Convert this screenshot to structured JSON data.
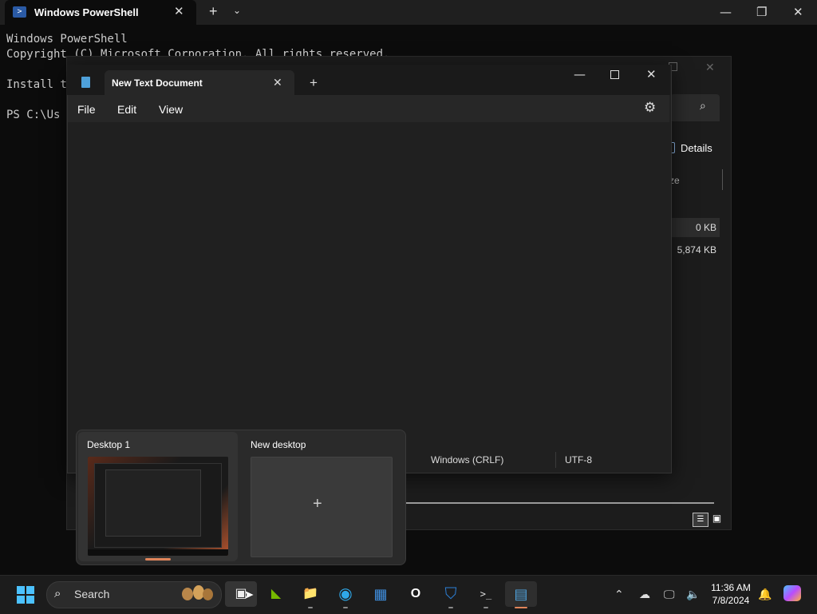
{
  "terminal": {
    "tab_title": "Windows PowerShell",
    "tab_icon": "powershell-icon",
    "lines": [
      "Windows PowerShell",
      "Copyright (C) Microsoft Corporation. All rights reserved.",
      "",
      "Install t",
      "",
      "PS C:\\Us"
    ],
    "new_tab_glyph": "+",
    "dropdown_glyph": "⌄"
  },
  "explorer": {
    "view_label": "Details",
    "size_column": "ze",
    "rows": [
      {
        "size": "0 KB"
      },
      {
        "size": "5,874 KB"
      }
    ]
  },
  "notepad": {
    "tab_title": "New Text Document",
    "menus": [
      "File",
      "Edit",
      "View"
    ],
    "status": {
      "line_endings": "Windows (CRLF)",
      "encoding": "UTF-8"
    }
  },
  "task_view": {
    "desktops": [
      {
        "label": "Desktop 1",
        "active": true
      },
      {
        "label": "New desktop",
        "glyph": "+"
      }
    ]
  },
  "taskbar": {
    "search_placeholder": "Search",
    "apps": [
      {
        "name": "task-view",
        "glyph": "▣"
      },
      {
        "name": "nvidia",
        "glyph": "◣"
      },
      {
        "name": "file-explorer",
        "glyph": "📁"
      },
      {
        "name": "edge",
        "glyph": "◉"
      },
      {
        "name": "microsoft-store",
        "glyph": "▦"
      },
      {
        "name": "outlook-new",
        "glyph": "O"
      },
      {
        "name": "defender",
        "glyph": "⛉"
      },
      {
        "name": "terminal",
        "glyph": ">_"
      },
      {
        "name": "notepad",
        "glyph": "▤"
      }
    ],
    "clock": {
      "time": "11:36 AM",
      "date": "7/8/2024"
    }
  },
  "colors": {
    "accent": "#4cc2ff",
    "active_indicator": "#e0845a"
  }
}
